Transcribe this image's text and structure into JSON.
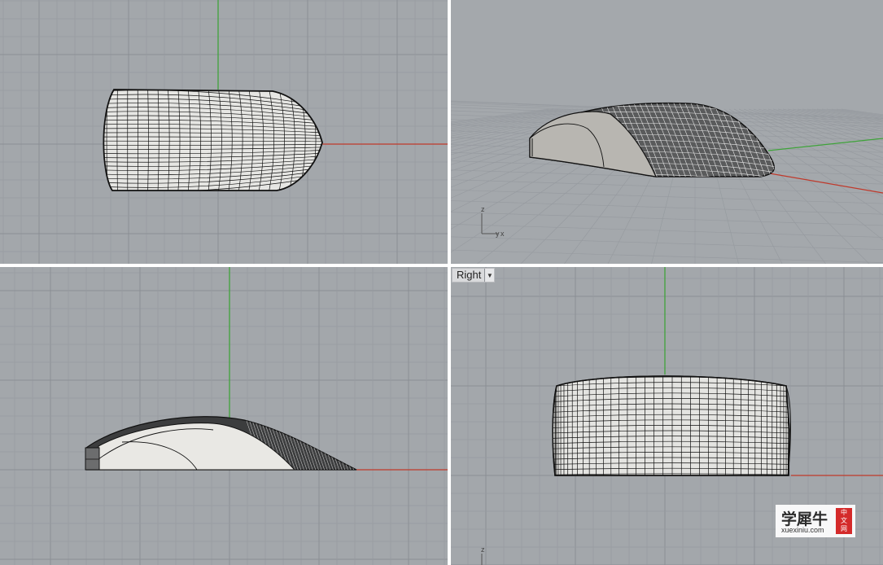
{
  "viewports": {
    "top": {
      "label": ""
    },
    "perspective": {
      "label": "",
      "axis_labels": {
        "z": "z",
        "y": "y",
        "x": "x"
      }
    },
    "front": {
      "label": ""
    },
    "right": {
      "label": "Right",
      "dropdown_icon": "triangle-down-icon",
      "axis_labels": {
        "z": "z"
      }
    }
  },
  "colors": {
    "viewport_bg": "#a3a7ab",
    "grid_minor": "#979ba0",
    "grid_major": "#8b8f94",
    "axis_x": "#c0392b",
    "axis_y": "#3fa33a",
    "surface_fill": "#e6e6e3",
    "wire": "#111111"
  },
  "watermark": {
    "title": "学犀牛",
    "url": "xuexiniu.com",
    "badge": [
      "中",
      "文",
      "网"
    ]
  }
}
